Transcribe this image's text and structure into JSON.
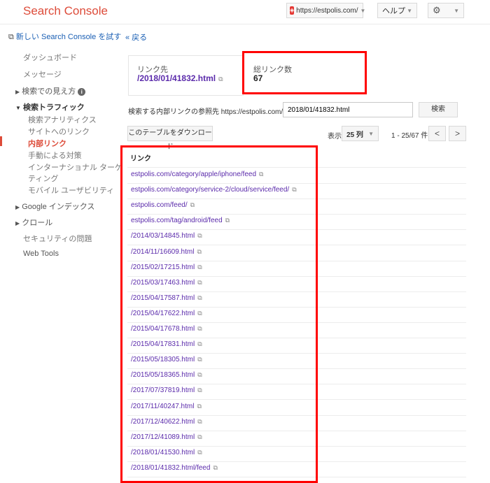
{
  "header": {
    "app_title": "Search Console",
    "site_url": "https://estpolis.com/",
    "help_label": "ヘルプ"
  },
  "sidebar": {
    "try_new": "新しい Search Console を試す",
    "dashboard": "ダッシュボード",
    "messages": "メッセージ",
    "search_appearance": "検索での見え方",
    "search_traffic": "検索トラフィック",
    "search_analytics": "検索アナリティクス",
    "links_to_site": "サイトへのリンク",
    "internal_links": "内部リンク",
    "manual_actions": "手動による対策",
    "intl_targeting_1": "インターナショナル ターゲ",
    "intl_targeting_2": "ティング",
    "mobile_usability": "モバイル ユーザビリティ",
    "google_index": "Google インデックス",
    "crawl": "クロール",
    "security": "セキュリティの問題",
    "web_tools": "Web Tools"
  },
  "main": {
    "back": "« 戻る",
    "target_label": "リンク先",
    "target_value": "/2018/01/41832.html",
    "total_label": "総リンク数",
    "total_value": "67",
    "search_label": "検索する内部リンクの参照先 https://estpolis.com/",
    "search_value": "2018/01/41832.html",
    "search_button": "検索",
    "download_button": "このテーブルをダウンロード",
    "display_label": "表示",
    "rows_value": "25 列",
    "range_text": "1 - 25/67 件",
    "column_header": "リンク",
    "links": [
      "estpolis.com/category/apple/iphone/feed",
      "estpolis.com/category/service-2/cloud/service/feed/",
      "estpolis.com/feed/",
      "estpolis.com/tag/android/feed",
      "/2014/03/14845.html",
      "/2014/11/16609.html",
      "/2015/02/17215.html",
      "/2015/03/17463.html",
      "/2015/04/17587.html",
      "/2015/04/17622.html",
      "/2015/04/17678.html",
      "/2015/04/17831.html",
      "/2015/05/18305.html",
      "/2015/05/18365.html",
      "/2017/07/37819.html",
      "/2017/11/40247.html",
      "/2017/12/40622.html",
      "/2017/12/41089.html",
      "/2018/01/41530.html",
      "/2018/01/41832.html/feed"
    ]
  },
  "colors": {
    "brand_red": "#dd4b39",
    "link_purple": "#5b2bab",
    "highlight_red": "#ff0000"
  }
}
